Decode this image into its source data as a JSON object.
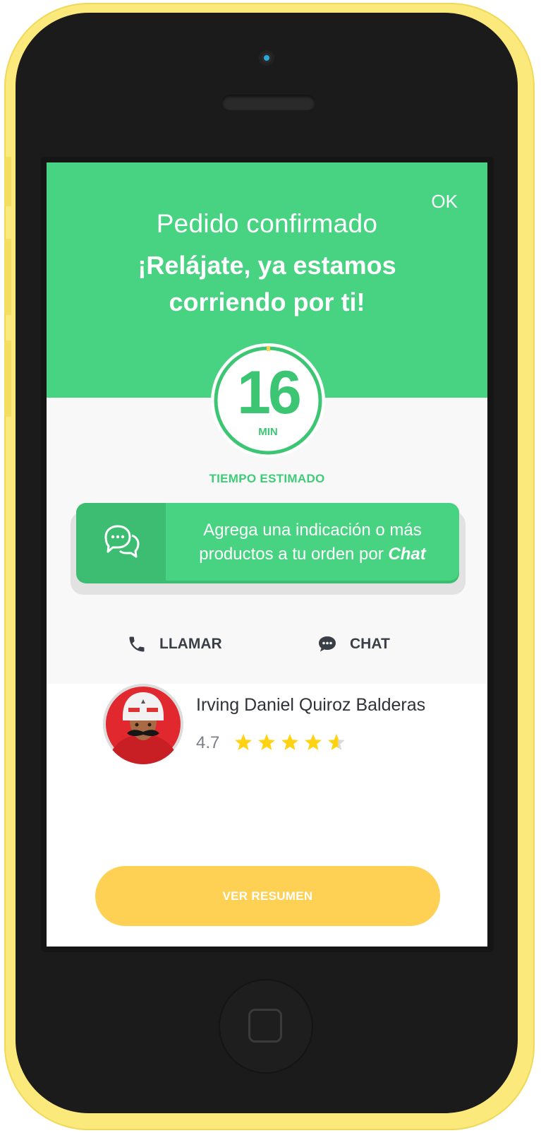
{
  "header": {
    "ok_label": "OK",
    "subtitle": "Pedido confirmado",
    "title": "¡Relájate, ya estamos corriendo por ti!"
  },
  "timer": {
    "minutes": "16",
    "unit": "MIN",
    "label": "TIEMPO ESTIMADO"
  },
  "chat_card": {
    "text": "Agrega una indicación o más productos a tu orden por",
    "emphasis": "Chat",
    "icon": "chat-bubbles-icon"
  },
  "actions": {
    "call_label": "LLAMAR",
    "call_icon": "phone-icon",
    "chat_label": "CHAT",
    "chat_icon": "chat-bubble-icon"
  },
  "driver": {
    "name": "Irving Daniel Quiroz Balderas",
    "rating": "4.7"
  },
  "cta": {
    "label": "VER RESUMEN"
  },
  "colors": {
    "primary_green": "#47d381",
    "accent_yellow": "#fed054",
    "star_yellow": "#ffd313",
    "phone_shell": "#fbe97c"
  }
}
